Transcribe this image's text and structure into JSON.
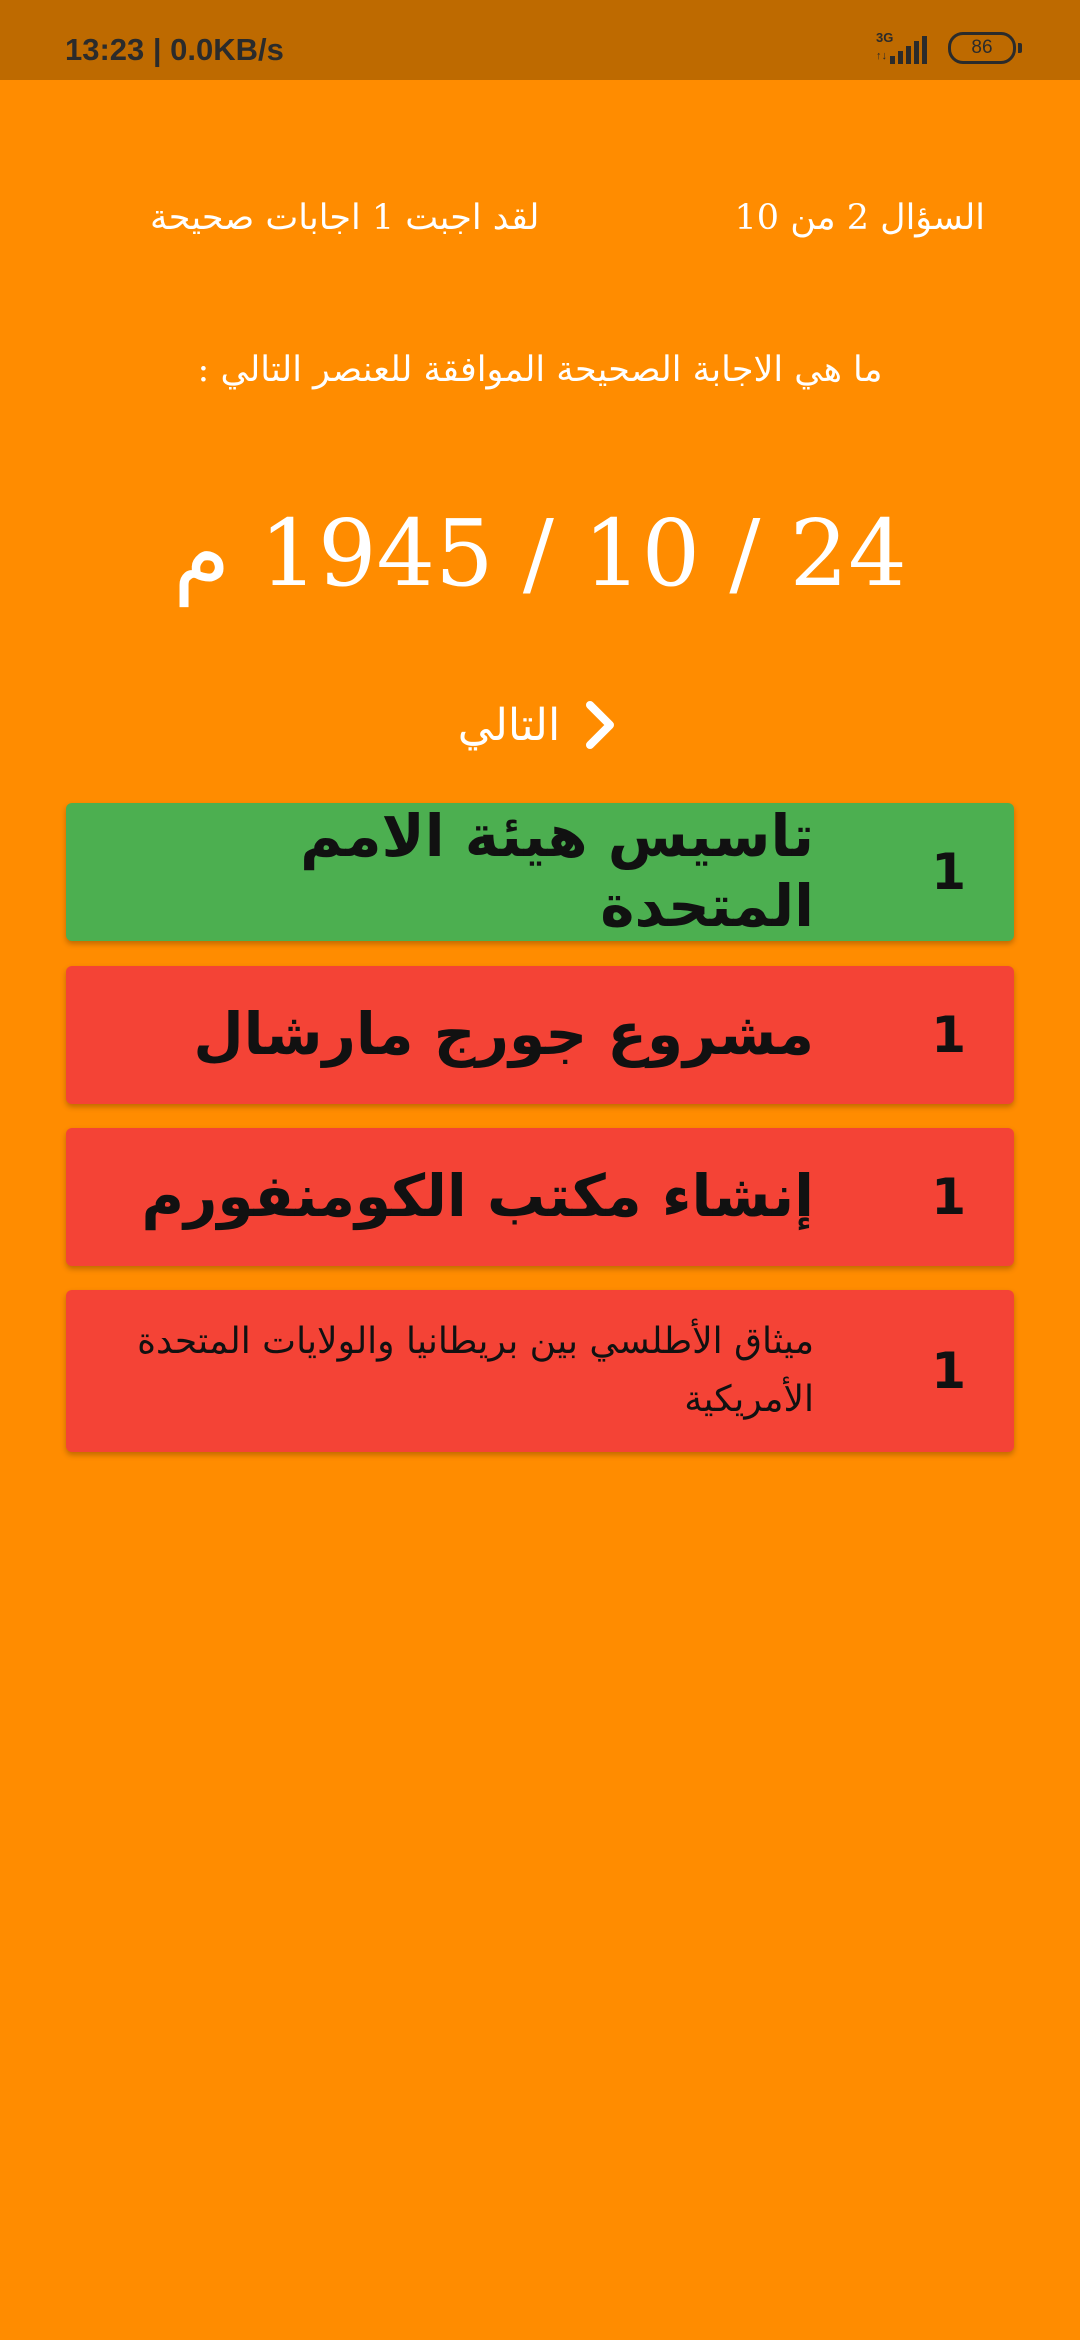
{
  "status_bar": {
    "time": "13:23 | 0.0KB/s",
    "network": "3G",
    "network_arrows": "↑↓",
    "battery": "86",
    "icons": [
      "signal-icon",
      "battery-icon"
    ]
  },
  "quiz": {
    "counter": "السؤال 2 من 10",
    "score": "لقد اجبت 1 اجابات صحيحة",
    "question": "ما هي الاجابة الصحيحة الموافقة للعنصر التالي :",
    "subject": "24 / 10 / 1945 م",
    "next_label": "التالي",
    "next_icon": "chevron-right-icon"
  },
  "answers": [
    {
      "number": "1",
      "text": "تاسيس هيئة الامم المتحدة",
      "state": "correct",
      "color": "#4CAF50"
    },
    {
      "number": "1",
      "text": "مشروع جورج مارشال",
      "state": "wrong",
      "color": "#F44336"
    },
    {
      "number": "1",
      "text": "إنشاء مكتب الكومنفورم",
      "state": "wrong",
      "color": "#F44336"
    },
    {
      "number": "1",
      "text": "ميثاق الأطلسي بين بريطانيا والولايات المتحدة الأمريكية",
      "state": "wrong",
      "color": "#F44336"
    }
  ],
  "colors": {
    "background": "#FF8C00",
    "status_bar": "#BE6A00",
    "correct": "#4CAF50",
    "wrong": "#F44336"
  }
}
